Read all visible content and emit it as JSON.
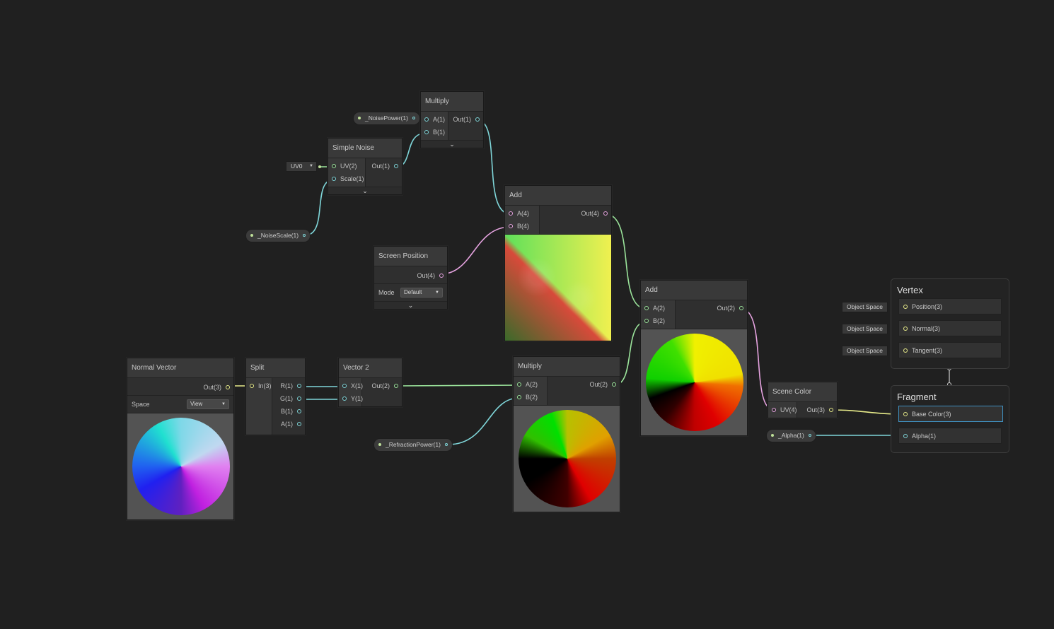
{
  "colors": {
    "background": "#202020",
    "float_port": "#7fd6d9",
    "vector2_port": "#9be49b",
    "vector3_port": "#e8ec8a",
    "vector4_port": "#e6a3e0",
    "selection": "#3f8fbf"
  },
  "nodes": {
    "multiply_top": {
      "title": "Multiply",
      "inputs": [
        "A(1)",
        "B(1)"
      ],
      "outputs": [
        "Out(1)"
      ]
    },
    "simple_noise": {
      "title": "Simple Noise",
      "inputs": [
        "UV(2)",
        "Scale(1)"
      ],
      "outputs": [
        "Out(1)"
      ]
    },
    "uv_dropdown": {
      "value": "UV0"
    },
    "add_top": {
      "title": "Add",
      "inputs": [
        "A(4)",
        "B(4)"
      ],
      "outputs": [
        "Out(4)"
      ]
    },
    "screen_position": {
      "title": "Screen Position",
      "outputs": [
        "Out(4)"
      ],
      "mode_label": "Mode",
      "mode_value": "Default"
    },
    "normal_vector": {
      "title": "Normal Vector",
      "outputs": [
        "Out(3)"
      ],
      "space_label": "Space",
      "space_value": "View"
    },
    "split": {
      "title": "Split",
      "inputs": [
        "In(3)"
      ],
      "outputs": [
        "R(1)",
        "G(1)",
        "B(1)",
        "A(1)"
      ]
    },
    "vector2": {
      "title": "Vector 2",
      "inputs": [
        "X(1)",
        "Y(1)"
      ],
      "outputs": [
        "Out(2)"
      ]
    },
    "multiply_bottom": {
      "title": "Multiply",
      "inputs": [
        "A(2)",
        "B(2)"
      ],
      "outputs": [
        "Out(2)"
      ]
    },
    "add_mid": {
      "title": "Add",
      "inputs": [
        "A(2)",
        "B(2)"
      ],
      "outputs": [
        "Out(2)"
      ]
    },
    "scene_color": {
      "title": "Scene Color",
      "inputs": [
        "UV(4)"
      ],
      "outputs": [
        "Out(3)"
      ]
    }
  },
  "properties": {
    "noise_power": "_NoisePower(1)",
    "noise_scale": "_NoiseScale(1)",
    "refraction_power": "_RefractionPower(1)",
    "alpha": "_Alpha(1)"
  },
  "master": {
    "vertex": {
      "title": "Vertex",
      "ports": [
        {
          "space": "Object Space",
          "label": "Position(3)"
        },
        {
          "space": "Object Space",
          "label": "Normal(3)"
        },
        {
          "space": "Object Space",
          "label": "Tangent(3)"
        }
      ]
    },
    "fragment": {
      "title": "Fragment",
      "ports": [
        {
          "label": "Base Color(3)",
          "selected": true
        },
        {
          "label": "Alpha(1)"
        }
      ]
    }
  }
}
